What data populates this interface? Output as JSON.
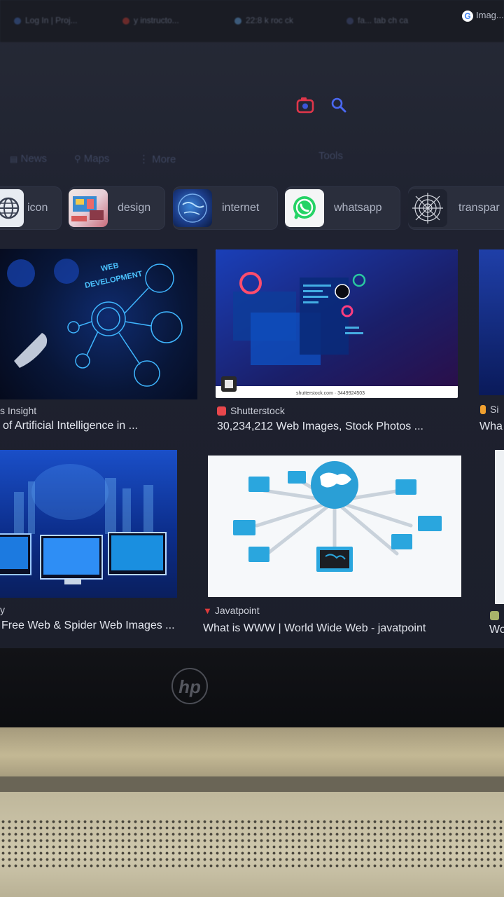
{
  "browser": {
    "tabs": [
      "Log In | Proj...",
      "y instructo...",
      "22:8 k roc ck",
      "fa... tab ch ca",
      "Imag..."
    ],
    "active_tab": "image"
  },
  "search": {
    "lens_icon": "google-lens-icon",
    "search_icon": "search-icon"
  },
  "nav": {
    "items": [
      "News",
      "Maps",
      "More"
    ],
    "tools_label": "Tools"
  },
  "chips": [
    {
      "label": "icon",
      "icon": "globe-icon"
    },
    {
      "label": "design",
      "icon": "design-thumb"
    },
    {
      "label": "internet",
      "icon": "earth-thumb"
    },
    {
      "label": "whatsapp",
      "icon": "whatsapp-icon"
    },
    {
      "label": "transpar",
      "icon": "spider-web-thumb"
    }
  ],
  "results": [
    {
      "source": "s Insight",
      "title": "of Artificial Intelligence in ...",
      "image_text": [
        "WEB",
        "DEVELOPMENT"
      ]
    },
    {
      "source": "Shutterstock",
      "title": "30,234,212 Web Images, Stock Photos ...",
      "image_caption": "shutterstock.com · 3449924503",
      "source_color": "#e8474c"
    },
    {
      "source": "Si",
      "title": "Wha"
    },
    {
      "source": "y",
      "title": "Free Web & Spider Web Images ..."
    },
    {
      "source": "Javatpoint",
      "title": "What is WWW | World Wide Web - javatpoint",
      "source_color": "#e03b3b"
    },
    {
      "source": "",
      "title": "Wo"
    }
  ],
  "laptop": {
    "brand": "hp"
  }
}
